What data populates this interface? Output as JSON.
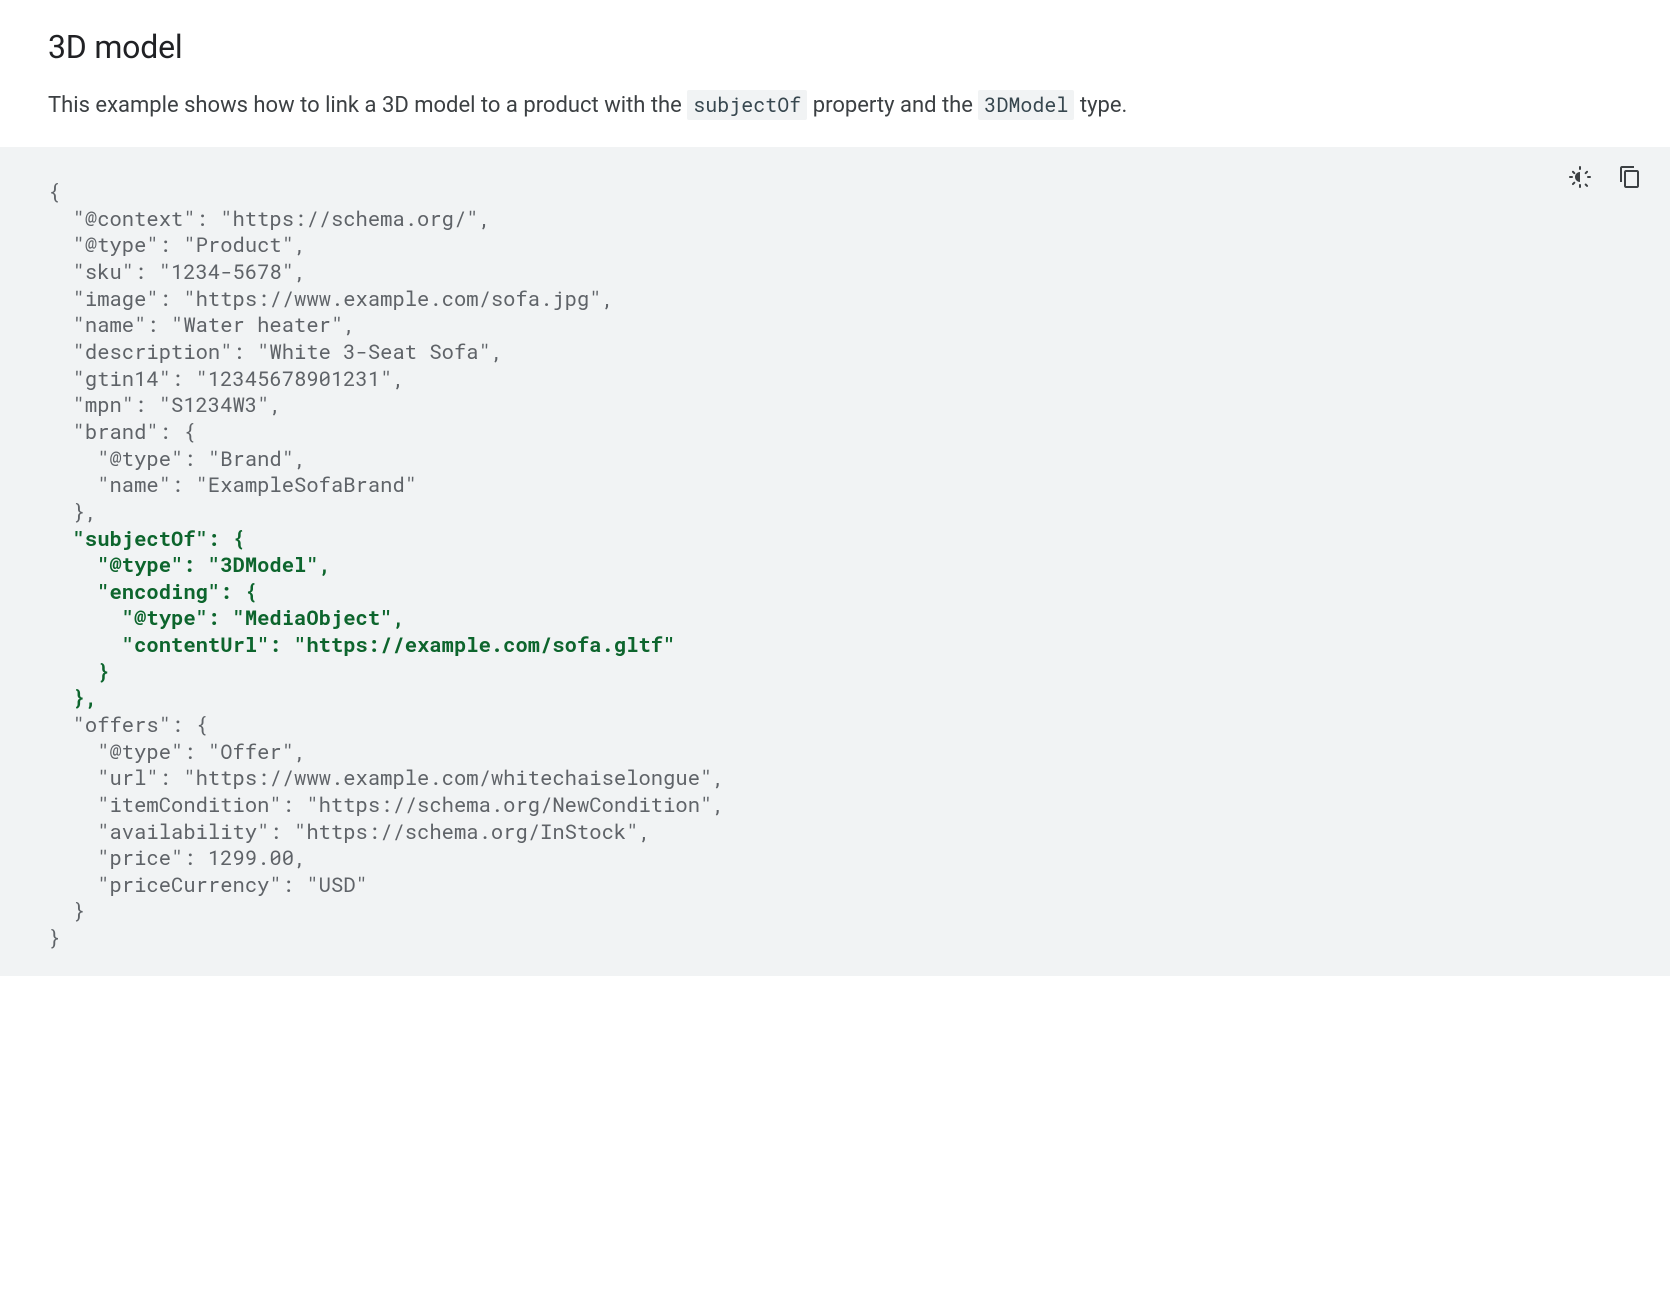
{
  "heading": "3D model",
  "intro": {
    "pre": "This example shows how to link a 3D model to a product with the ",
    "code1": "subjectOf",
    "mid": " property and the ",
    "code2": "3DModel",
    "post": " type."
  },
  "code": {
    "lines": [
      {
        "text": "{",
        "hl": false,
        "indent": 0
      },
      {
        "text": "\"@context\": \"https://schema.org/\",",
        "hl": false,
        "indent": 1
      },
      {
        "text": "\"@type\": \"Product\",",
        "hl": false,
        "indent": 1
      },
      {
        "text": "\"sku\": \"1234-5678\",",
        "hl": false,
        "indent": 1
      },
      {
        "text": "\"image\": \"https://www.example.com/sofa.jpg\",",
        "hl": false,
        "indent": 1
      },
      {
        "text": "\"name\": \"Water heater\",",
        "hl": false,
        "indent": 1
      },
      {
        "text": "\"description\": \"White 3-Seat Sofa\",",
        "hl": false,
        "indent": 1
      },
      {
        "text": "\"gtin14\": \"12345678901231\",",
        "hl": false,
        "indent": 1
      },
      {
        "text": "\"mpn\": \"S1234W3\",",
        "hl": false,
        "indent": 1
      },
      {
        "text": "\"brand\": {",
        "hl": false,
        "indent": 1
      },
      {
        "text": "\"@type\": \"Brand\",",
        "hl": false,
        "indent": 2
      },
      {
        "text": "\"name\": \"ExampleSofaBrand\"",
        "hl": false,
        "indent": 2
      },
      {
        "text": "},",
        "hl": false,
        "indent": 1
      },
      {
        "text": "\"subjectOf\": {",
        "hl": true,
        "indent": 1
      },
      {
        "text": "\"@type\": \"3DModel\",",
        "hl": true,
        "indent": 2
      },
      {
        "text": "\"encoding\": {",
        "hl": true,
        "indent": 2
      },
      {
        "text": "\"@type\": \"MediaObject\",",
        "hl": true,
        "indent": 3
      },
      {
        "text": "\"contentUrl\": \"https://example.com/sofa.gltf\"",
        "hl": true,
        "indent": 3
      },
      {
        "text": "}",
        "hl": true,
        "indent": 2
      },
      {
        "text": "},",
        "hl": true,
        "indent": 1
      },
      {
        "text": "\"offers\": {",
        "hl": false,
        "indent": 1
      },
      {
        "text": "\"@type\": \"Offer\",",
        "hl": false,
        "indent": 2
      },
      {
        "text": "\"url\": \"https://www.example.com/whitechaiselongue\",",
        "hl": false,
        "indent": 2
      },
      {
        "text": "\"itemCondition\": \"https://schema.org/NewCondition\",",
        "hl": false,
        "indent": 2
      },
      {
        "text": "\"availability\": \"https://schema.org/InStock\",",
        "hl": false,
        "indent": 2
      },
      {
        "text": "\"price\": 1299.00,",
        "hl": false,
        "indent": 2
      },
      {
        "text": "\"priceCurrency\": \"USD\"",
        "hl": false,
        "indent": 2
      },
      {
        "text": "}",
        "hl": false,
        "indent": 1
      },
      {
        "text": "}",
        "hl": false,
        "indent": 0
      }
    ]
  }
}
